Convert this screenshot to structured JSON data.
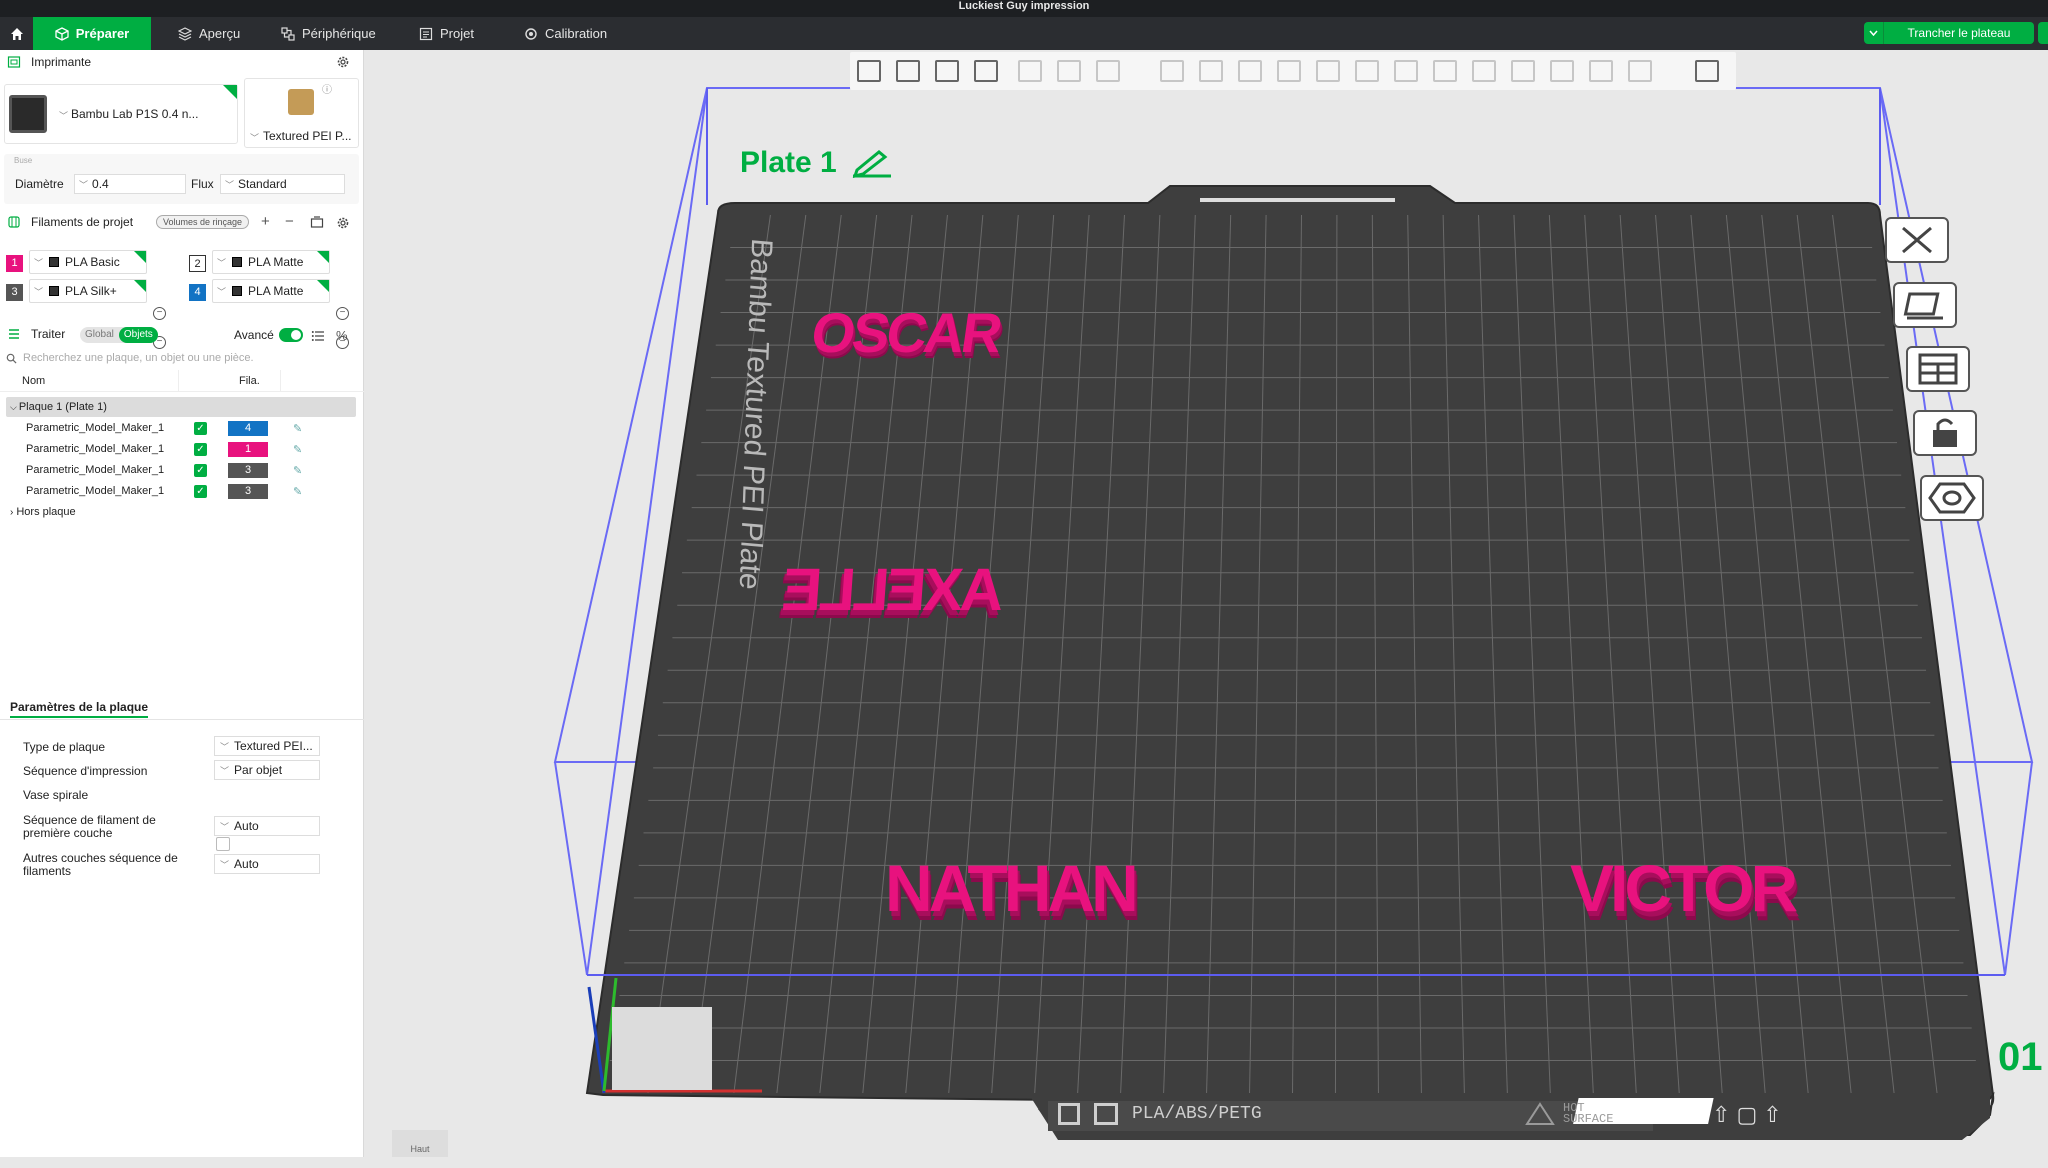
{
  "window": {
    "title": "Luckiest Guy impression"
  },
  "tabs": [
    {
      "label": "Préparer",
      "icon": "cube-icon"
    },
    {
      "label": "Aperçu",
      "icon": "layers-icon"
    },
    {
      "label": "Périphérique",
      "icon": "device-icon"
    },
    {
      "label": "Projet",
      "icon": "project-icon"
    },
    {
      "label": "Calibration",
      "icon": "calibration-icon"
    }
  ],
  "actions": {
    "slice": "Trancher le plateau"
  },
  "printer": {
    "section_title": "Imprimante",
    "name": "Bambu Lab P1S 0.4 n...",
    "plate": "Textured PEI P...",
    "nozzle_title": "Buse",
    "diameter_label": "Diamètre",
    "diameter_value": "0.4",
    "flow_label": "Flux",
    "flow_value": "Standard"
  },
  "filaments": {
    "section_title": "Filaments de projet",
    "flush_button": "Volumes de rinçage",
    "items": [
      {
        "num": "1",
        "name": "PLA Basic",
        "color": "#e8127e"
      },
      {
        "num": "2",
        "name": "PLA Matte",
        "color": "#ffffff"
      },
      {
        "num": "3",
        "name": "PLA Silk+",
        "color": "#555555"
      },
      {
        "num": "4",
        "name": "PLA Matte",
        "color": "#1273c4"
      }
    ]
  },
  "process": {
    "section_title": "Traiter",
    "seg_global": "Global",
    "seg_objects": "Objets",
    "advanced_label": "Avancé",
    "search_placeholder": "Recherchez une plaque, un objet ou une pièce.",
    "col_name": "Nom",
    "col_fil": "Fila.",
    "plate_row": "Plaque 1 (Plate 1)",
    "objects": [
      {
        "name": "Parametric_Model_Maker_1",
        "filament": "4",
        "color": "#1273c4"
      },
      {
        "name": "Parametric_Model_Maker_1",
        "filament": "1",
        "color": "#e8127e"
      },
      {
        "name": "Parametric_Model_Maker_1",
        "filament": "3",
        "color": "#555555"
      },
      {
        "name": "Parametric_Model_Maker_1",
        "filament": "3",
        "color": "#555555"
      }
    ],
    "off_plate": "Hors plaque"
  },
  "plate_params": {
    "title": "Paramètres de la plaque",
    "plate_type_label": "Type de plaque",
    "plate_type_value": "Textured PEI...",
    "print_seq_label": "Séquence d'impression",
    "print_seq_value": "Par objet",
    "vase_label": "Vase spirale",
    "first_layer_label": "Séquence de filament de première couche",
    "first_layer_value": "Auto",
    "other_layers_label": "Autres couches séquence de filaments",
    "other_layers_value": "Auto"
  },
  "viewport": {
    "plate_title": "Plate 1",
    "plate_brand": "Bambu Textured PEI Plate",
    "plate_material": "PLA/ABS/PETG",
    "hot_surface_1": "HOT",
    "hot_surface_2": "SURFACE",
    "plate_number": "01",
    "view_label": "Haut",
    "models": [
      "OSCAR",
      "AXELLE",
      "NATHAN",
      "VICTOR"
    ],
    "model_color": "#e8127e"
  },
  "colors": {
    "accent": "#00ae42",
    "bed": "#3e3e3e",
    "bounds": "#5c5cf0"
  }
}
